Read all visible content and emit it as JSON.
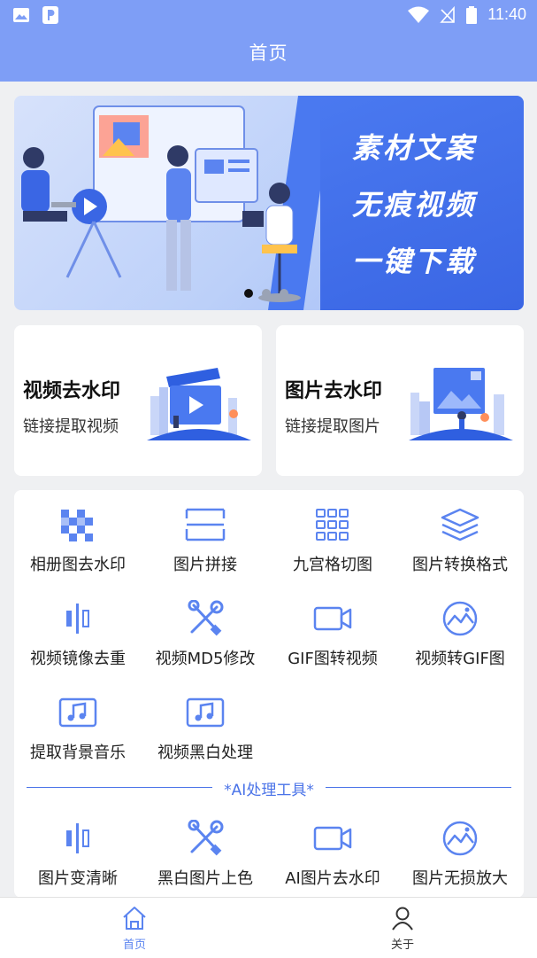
{
  "status_bar": {
    "time": "11:40"
  },
  "header": {
    "title": "首页"
  },
  "banner": {
    "slogan": [
      "素材文案",
      "无痕视频",
      "一键下载"
    ],
    "dots": 3,
    "active_dot": 0
  },
  "cards": [
    {
      "title": "视频去水印",
      "subtitle": "链接提取视频"
    },
    {
      "title": "图片去水印",
      "subtitle": "链接提取图片"
    }
  ],
  "tools": [
    {
      "label": "相册图去水印",
      "icon": "mosaic-icon"
    },
    {
      "label": "图片拼接",
      "icon": "image-stitch-icon"
    },
    {
      "label": "九宫格切图",
      "icon": "grid-nine-icon"
    },
    {
      "label": "图片转换格式",
      "icon": "layers-icon"
    },
    {
      "label": "视频镜像去重",
      "icon": "mirror-icon"
    },
    {
      "label": "视频MD5修改",
      "icon": "tools-icon"
    },
    {
      "label": "GIF图转视频",
      "icon": "video-camera-icon"
    },
    {
      "label": "视频转GIF图",
      "icon": "gif-image-icon"
    },
    {
      "label": "提取背景音乐",
      "icon": "music-icon"
    },
    {
      "label": "视频黑白处理",
      "icon": "music-icon"
    }
  ],
  "ai_section": {
    "title": "*AI处理工具*"
  },
  "ai_tools": [
    {
      "label": "图片变清晰",
      "icon": "mirror-icon"
    },
    {
      "label": "黑白图片上色",
      "icon": "tools-icon"
    },
    {
      "label": "AI图片去水印",
      "icon": "video-camera-icon"
    },
    {
      "label": "图片无损放大",
      "icon": "gif-image-icon"
    }
  ],
  "bottom_nav": [
    {
      "label": "首页",
      "icon": "home-icon",
      "active": true
    },
    {
      "label": "关于",
      "icon": "user-icon",
      "active": false
    }
  ],
  "colors": {
    "primary": "#7e9ef6",
    "accent": "#4a73e8",
    "icon": "#5b84f0",
    "background": "#eff0f2"
  }
}
